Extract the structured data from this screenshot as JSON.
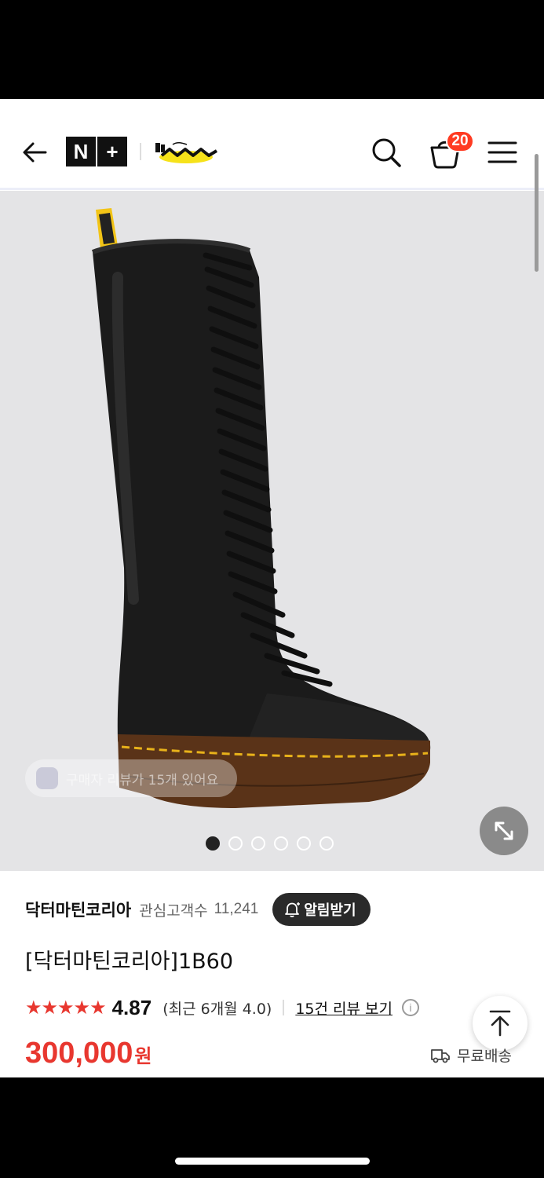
{
  "header": {
    "nplus_labels": [
      "N",
      "+"
    ],
    "cart_count": "20",
    "icons": [
      "back-arrow-icon",
      "search-icon",
      "cart-icon",
      "menu-icon",
      "expand-icon",
      "bell-icon",
      "info-icon",
      "arrow-up-icon",
      "truck-icon"
    ]
  },
  "image": {
    "review_overlay": "구매자 리뷰가 15개 있어요",
    "slides_total": 6,
    "slide_active": 1
  },
  "store": {
    "name": "닥터마틴코리아",
    "watchers_label": "관심고객수",
    "watchers_count": "11,241",
    "alarm_label": "알림받기"
  },
  "product": {
    "title": "[닥터마틴코리아]1B60",
    "stars": "★★★★★",
    "rating": "4.87",
    "recent_rating": "(최근 6개월 4.0)",
    "review_link": "15건 리뷰 보기",
    "price": "300,000",
    "price_unit": "원",
    "shipping": "무료배송"
  },
  "colors": {
    "accent_red": "#e8372f",
    "badge_red": "#ff3b22",
    "image_bg": "#e4e4e6"
  }
}
